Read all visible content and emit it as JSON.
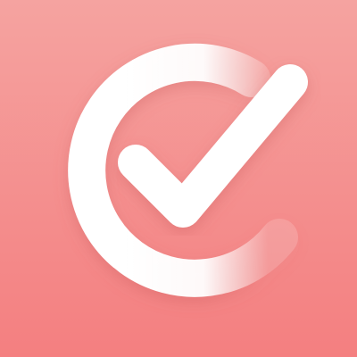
{
  "icon": {
    "name": "checkmark-task-app-icon",
    "glyph": "check-circle-icon",
    "colors": {
      "background_top": "#f5a3a0",
      "background_bottom": "#f47f80",
      "glyph": "#ffffff"
    }
  }
}
